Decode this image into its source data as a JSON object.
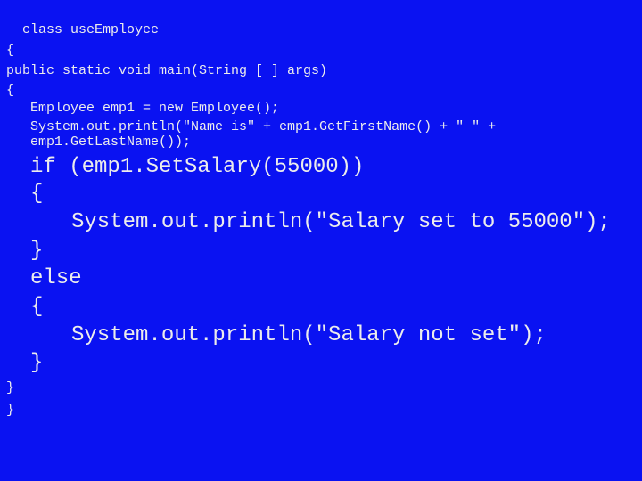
{
  "code": {
    "lines": [
      "class useEmployee",
      "{",
      "public static void main(String [ ] args)",
      "{",
      "Employee emp1 = new Employee();",
      "System.out.println(\"Name is\" + emp1.GetFirstName() + \" \" +",
      "emp1.GetLastName());",
      "if (emp1.SetSalary(55000))",
      "{",
      "System.out.println(\"Salary set to 55000\");",
      "}",
      "else",
      "{",
      "System.out.println(\"Salary not set\");",
      "}",
      "}",
      "}"
    ]
  },
  "colors": {
    "background": "#0a12f2",
    "text": "#ececec"
  }
}
